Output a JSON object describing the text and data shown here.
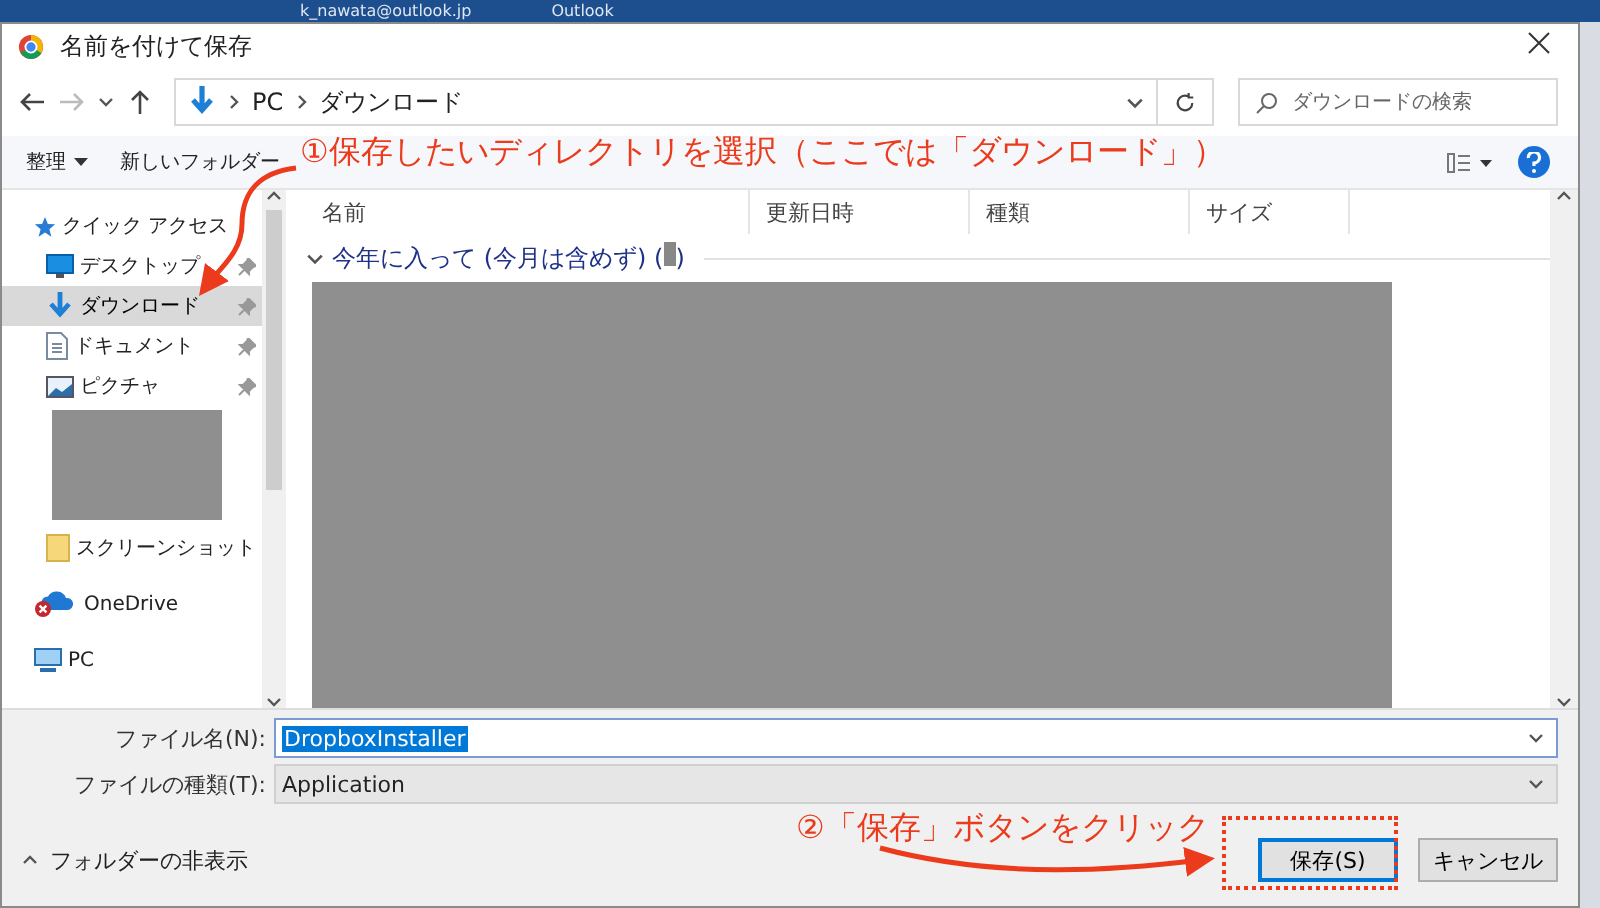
{
  "background_window": {
    "title_parts": [
      "k_nawata@outlook.jp",
      "Outlook"
    ]
  },
  "window": {
    "title": "名前を付けて保存"
  },
  "address": {
    "path": [
      "PC",
      "ダウンロード"
    ]
  },
  "search": {
    "placeholder": "ダウンロードの検索"
  },
  "toolbar": {
    "organize": "整理",
    "new_folder": "新しいフォルダー"
  },
  "nav": [
    {
      "kind": "star",
      "label": "クイック アクセス",
      "selected": false,
      "pinned": false,
      "children": [
        {
          "kind": "desktop",
          "label": "デスクトップ",
          "selected": false,
          "pinned": true
        },
        {
          "kind": "download",
          "label": "ダウンロード",
          "selected": true,
          "pinned": true
        },
        {
          "kind": "document",
          "label": "ドキュメント",
          "selected": false,
          "pinned": true
        },
        {
          "kind": "picture",
          "label": "ピクチャ",
          "selected": false,
          "pinned": true
        },
        {
          "kind": "redacted"
        },
        {
          "kind": "folder",
          "label": "スクリーンショット",
          "selected": false,
          "pinned": false
        }
      ]
    },
    {
      "kind": "cloud",
      "label": "OneDrive",
      "selected": false,
      "pinned": false
    },
    {
      "kind": "pc",
      "label": "PC",
      "selected": false,
      "pinned": false
    }
  ],
  "columns": [
    "名前",
    "更新日時",
    "種類",
    "サイズ"
  ],
  "group": {
    "label": "今年に入って (今月は含めず) (",
    "label_end": ")",
    "expanded": true
  },
  "file_name": {
    "label": "ファイル名(N):",
    "value": "DropboxInstaller"
  },
  "file_type": {
    "label": "ファイルの種類(T):",
    "value": "Application"
  },
  "hide_folders": "フォルダーの非表示",
  "buttons": [
    {
      "label": "保存(S)",
      "kind": "primary"
    },
    {
      "label": "キャンセル",
      "kind": "normal"
    }
  ],
  "annotations": [
    {
      "text": "①保存したいディレクトリを選択（ここでは「ダウンロード」）"
    },
    {
      "text": "②「保存」ボタンをクリック"
    }
  ]
}
